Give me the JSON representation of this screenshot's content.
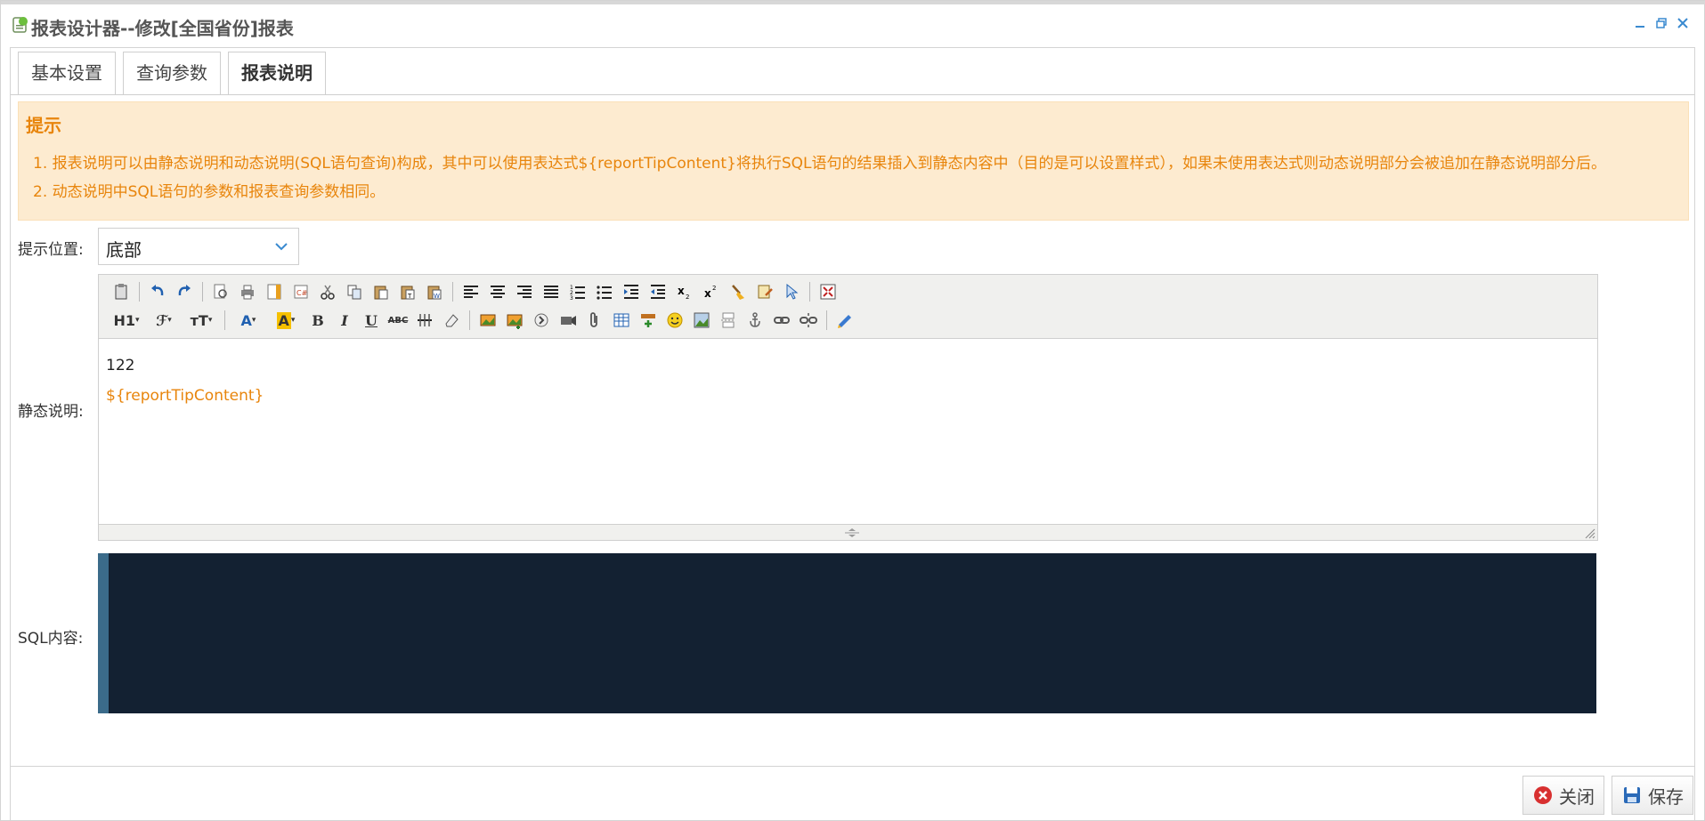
{
  "window": {
    "title": "报表设计器--修改[全国省份]报表",
    "controls": [
      "minimize-icon",
      "restore-icon",
      "close-icon"
    ]
  },
  "tabs": [
    {
      "label": "基本设置",
      "active": false
    },
    {
      "label": "查询参数",
      "active": false
    },
    {
      "label": "报表说明",
      "active": true
    }
  ],
  "tip": {
    "title": "提示",
    "lines": [
      "1. 报表说明可以由静态说明和动态说明(SQL语句查询)构成，其中可以使用表达式${reportTipContent}将执行SQL语句的结果插入到静态内容中（目的是可以设置样式），如果未使用表达式则动态说明部分会被追加在静态说明部分后。",
      "2. 动态说明中SQL语句的参数和报表查询参数相同。"
    ]
  },
  "form": {
    "position_label": "提示位置:",
    "position_value": "底部",
    "static_label": "静态说明:",
    "sql_label": "SQL内容:"
  },
  "editor": {
    "content_line1": "122",
    "content_line2": "${reportTipContent}",
    "toolbar_labels": {
      "h1": "H1",
      "font_family": "ℱ",
      "font_size": "тT",
      "font_color": "A",
      "bg_color": "A",
      "bold": "B",
      "italic": "I",
      "underline": "U",
      "strike": "ABC"
    }
  },
  "footer": {
    "close_label": "关闭",
    "save_label": "保存"
  },
  "colors": {
    "accent": "#e8850c",
    "tip_bg": "#fdebd0",
    "sql_bg": "#132132",
    "link_blue": "#3a8ad0"
  }
}
